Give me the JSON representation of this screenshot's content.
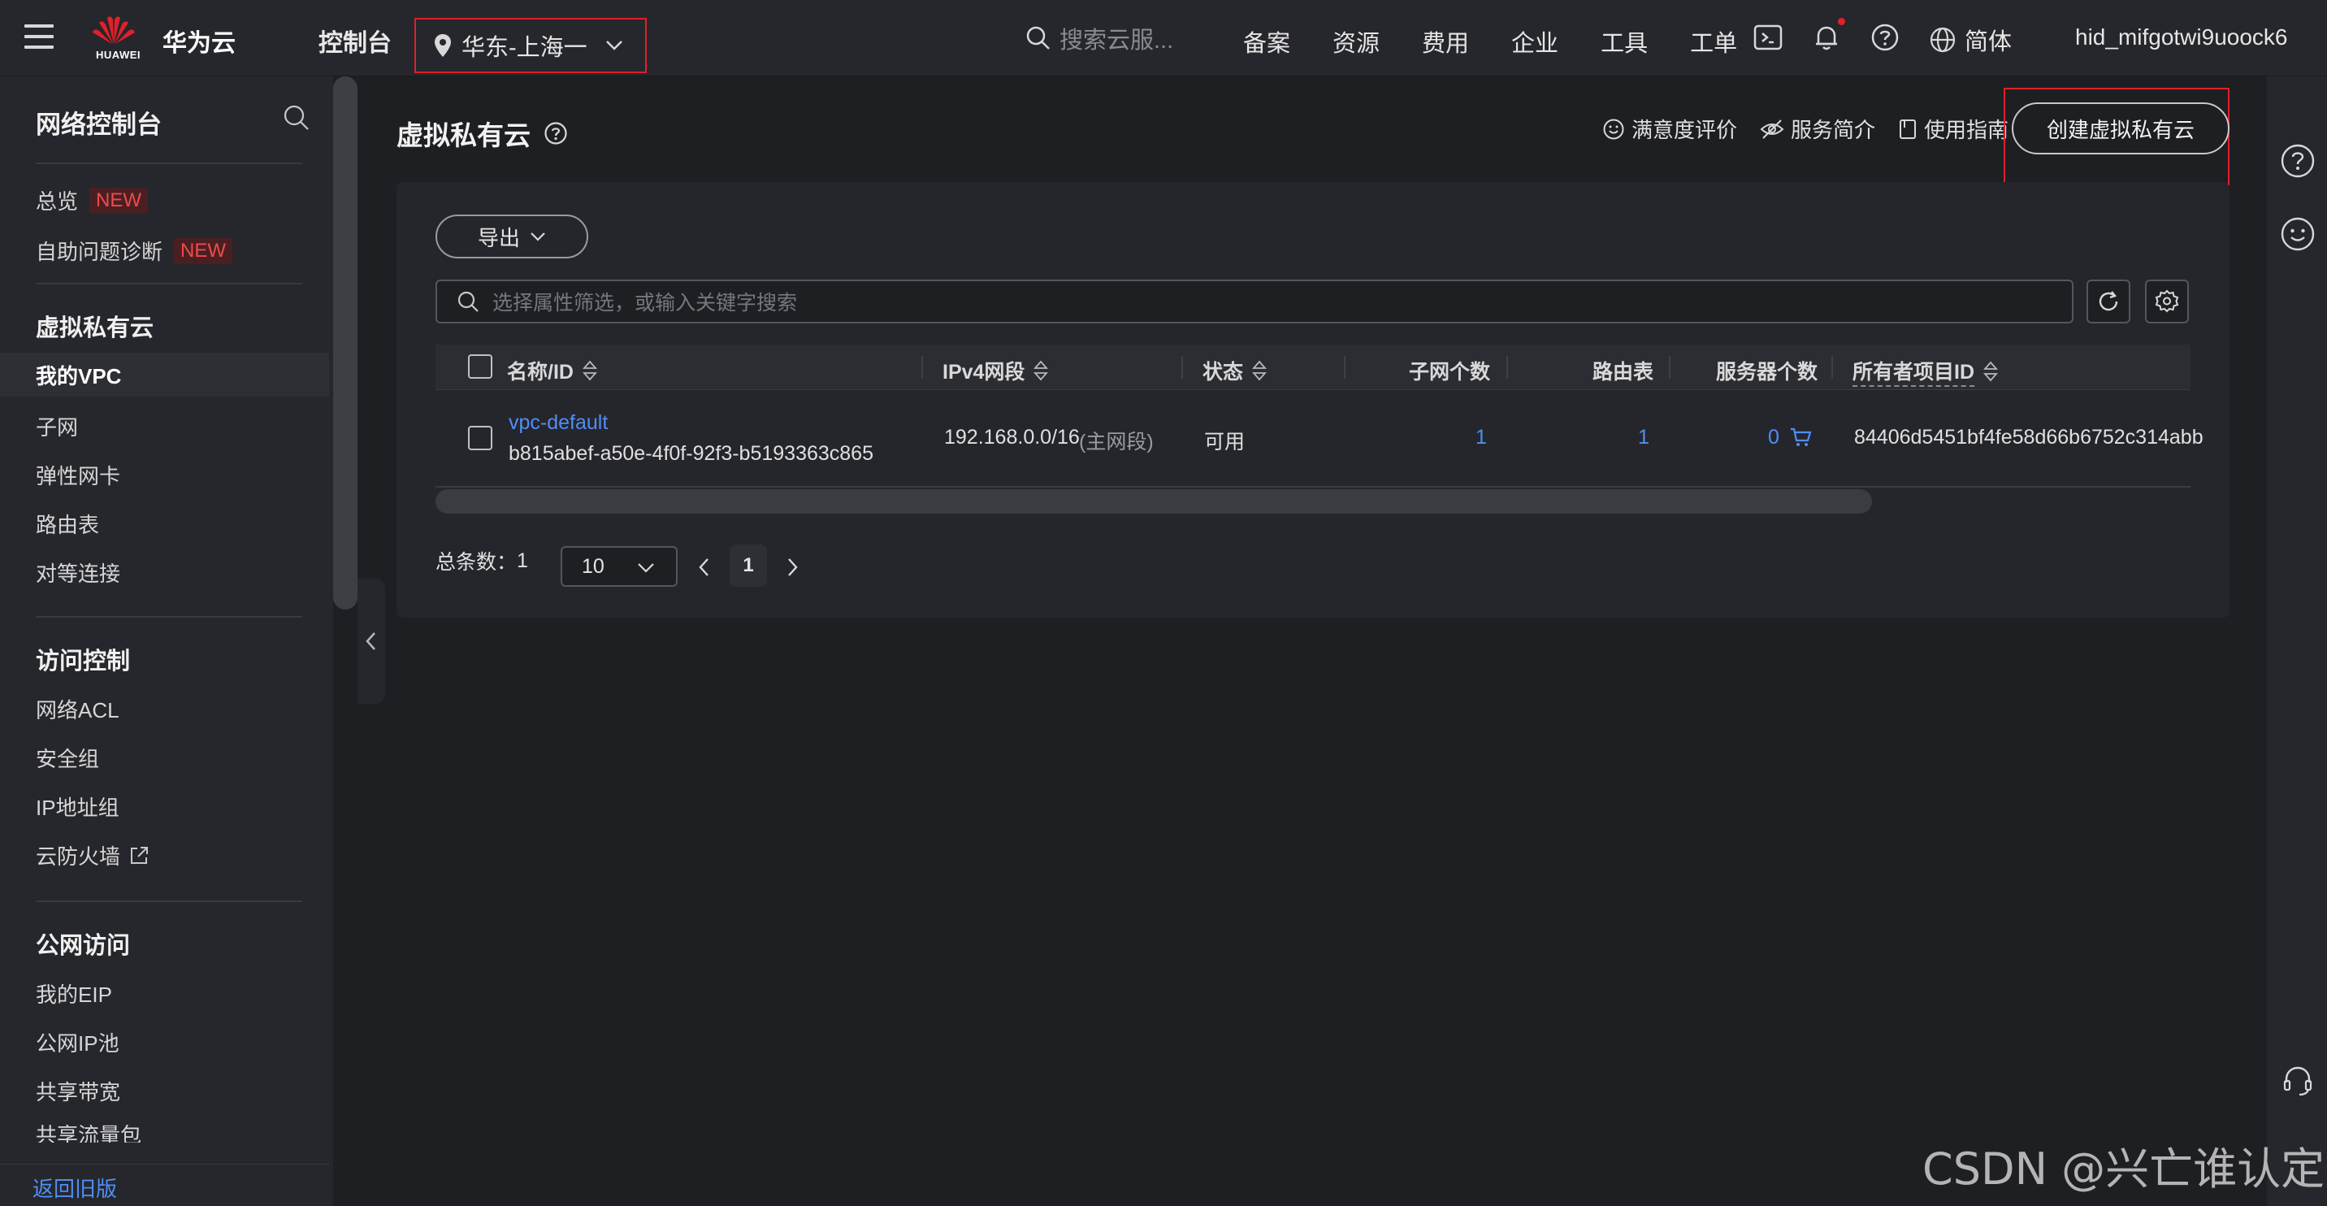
{
  "topbar": {
    "brand_small": "HUAWEI",
    "brand_name": "华为云",
    "console": "控制台",
    "region": "华东-上海一",
    "search_placeholder": "搜索云服...",
    "nav": [
      "备案",
      "资源",
      "费用",
      "企业",
      "工具",
      "工单"
    ],
    "language": "简体",
    "username": "hid_mifgotwi9uoock6"
  },
  "sidebar": {
    "title": "网络控制台",
    "top_items": [
      {
        "label": "总览",
        "badge": "NEW"
      },
      {
        "label": "自助问题诊断",
        "badge": "NEW"
      }
    ],
    "sections": [
      {
        "title": "虚拟私有云",
        "items": [
          "我的VPC",
          "子网",
          "弹性网卡",
          "路由表",
          "对等连接"
        ]
      },
      {
        "title": "访问控制",
        "items": [
          "网络ACL",
          "安全组",
          "IP地址组",
          "云防火墙"
        ]
      },
      {
        "title": "公网访问",
        "items": [
          "我的EIP",
          "公网IP池",
          "共享带宽",
          "共享流量包"
        ]
      }
    ],
    "back_link": "返回旧版"
  },
  "page": {
    "title": "虚拟私有云",
    "links": [
      "满意度评价",
      "服务简介",
      "使用指南"
    ],
    "create_button": "创建虚拟私有云",
    "export_button": "导出",
    "filter_placeholder": "选择属性筛选，或输入关键字搜索"
  },
  "table": {
    "columns": [
      "名称/ID",
      "IPv4网段",
      "状态",
      "子网个数",
      "路由表",
      "服务器个数",
      "所有者项目ID"
    ],
    "rows": [
      {
        "name": "vpc-default",
        "id": "b815abef-a50e-4f0f-92f3-b5193363c865",
        "cidr": "192.168.0.0/16",
        "cidr_note": "(主网段)",
        "status": "可用",
        "subnets": "1",
        "route_tables": "1",
        "servers": "0",
        "owner_project_id": "84406d5451bf4fe58d66b6752c314abb"
      }
    ]
  },
  "pagination": {
    "total_label": "总条数：",
    "total": "1",
    "page_size": "10",
    "current_page": "1"
  },
  "watermark": "CSDN @兴亡谁认定"
}
